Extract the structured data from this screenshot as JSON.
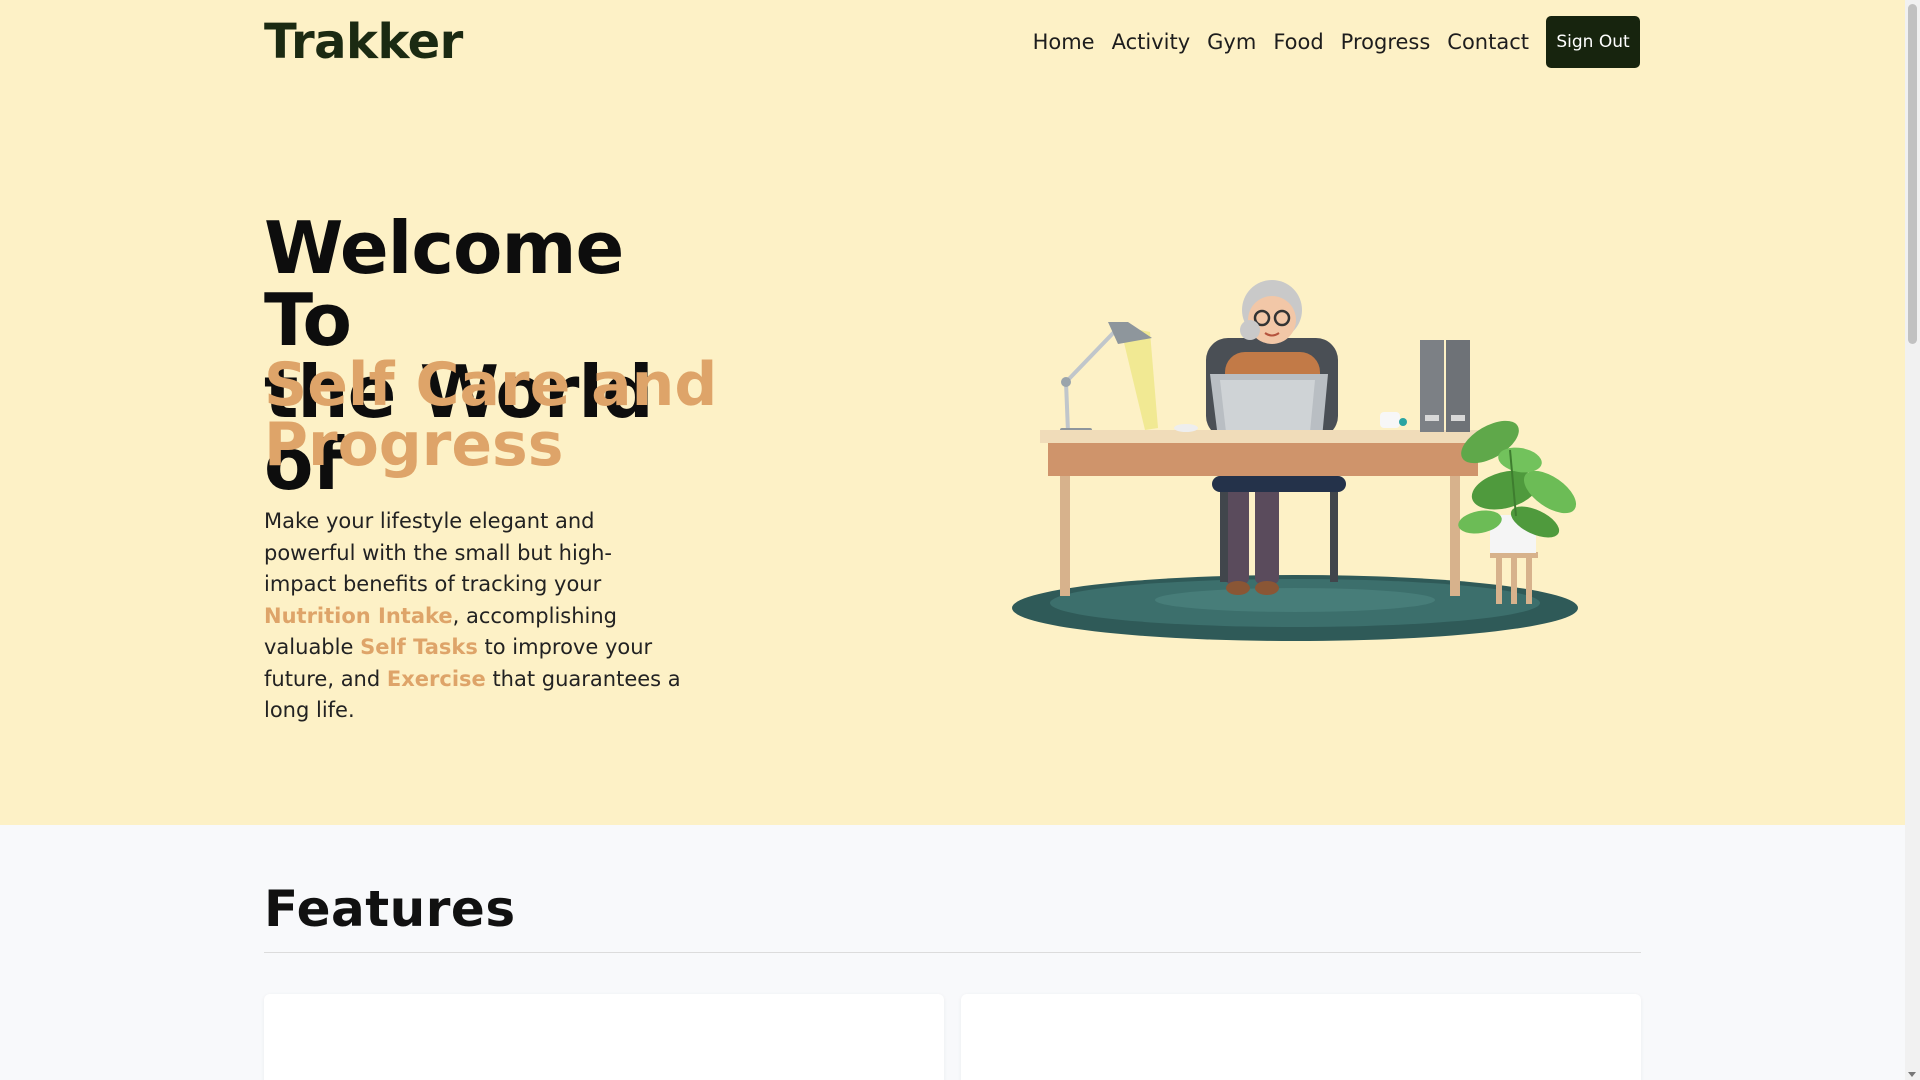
{
  "header": {
    "brand": "Trakker",
    "nav": [
      "Home",
      "Activity",
      "Gym",
      "Food",
      "Progress",
      "Contact"
    ],
    "signout_label": "Sign Out"
  },
  "hero": {
    "headline_line1": "Welcome To",
    "headline_line2": "the World of",
    "accent_line1": "Self Care and",
    "accent_line2": "Progress",
    "lead": {
      "part1": "Make your lifestyle elegant and powerful with the small but high-impact benefits of tracking your ",
      "hl1": "Nutrition Intake",
      "part2": ", accomplishing valuable ",
      "hl2": "Self Tasks",
      "part3": " to improve your future, and ",
      "hl3": "Exercise",
      "part4": " that guarantees a long life."
    },
    "illustration_icon": "woman-at-desk-illustration"
  },
  "features": {
    "title": "Features"
  },
  "colors": {
    "hero_bg": "#fdf1c6",
    "accent": "#dea469",
    "brand_dark": "#17240e"
  }
}
